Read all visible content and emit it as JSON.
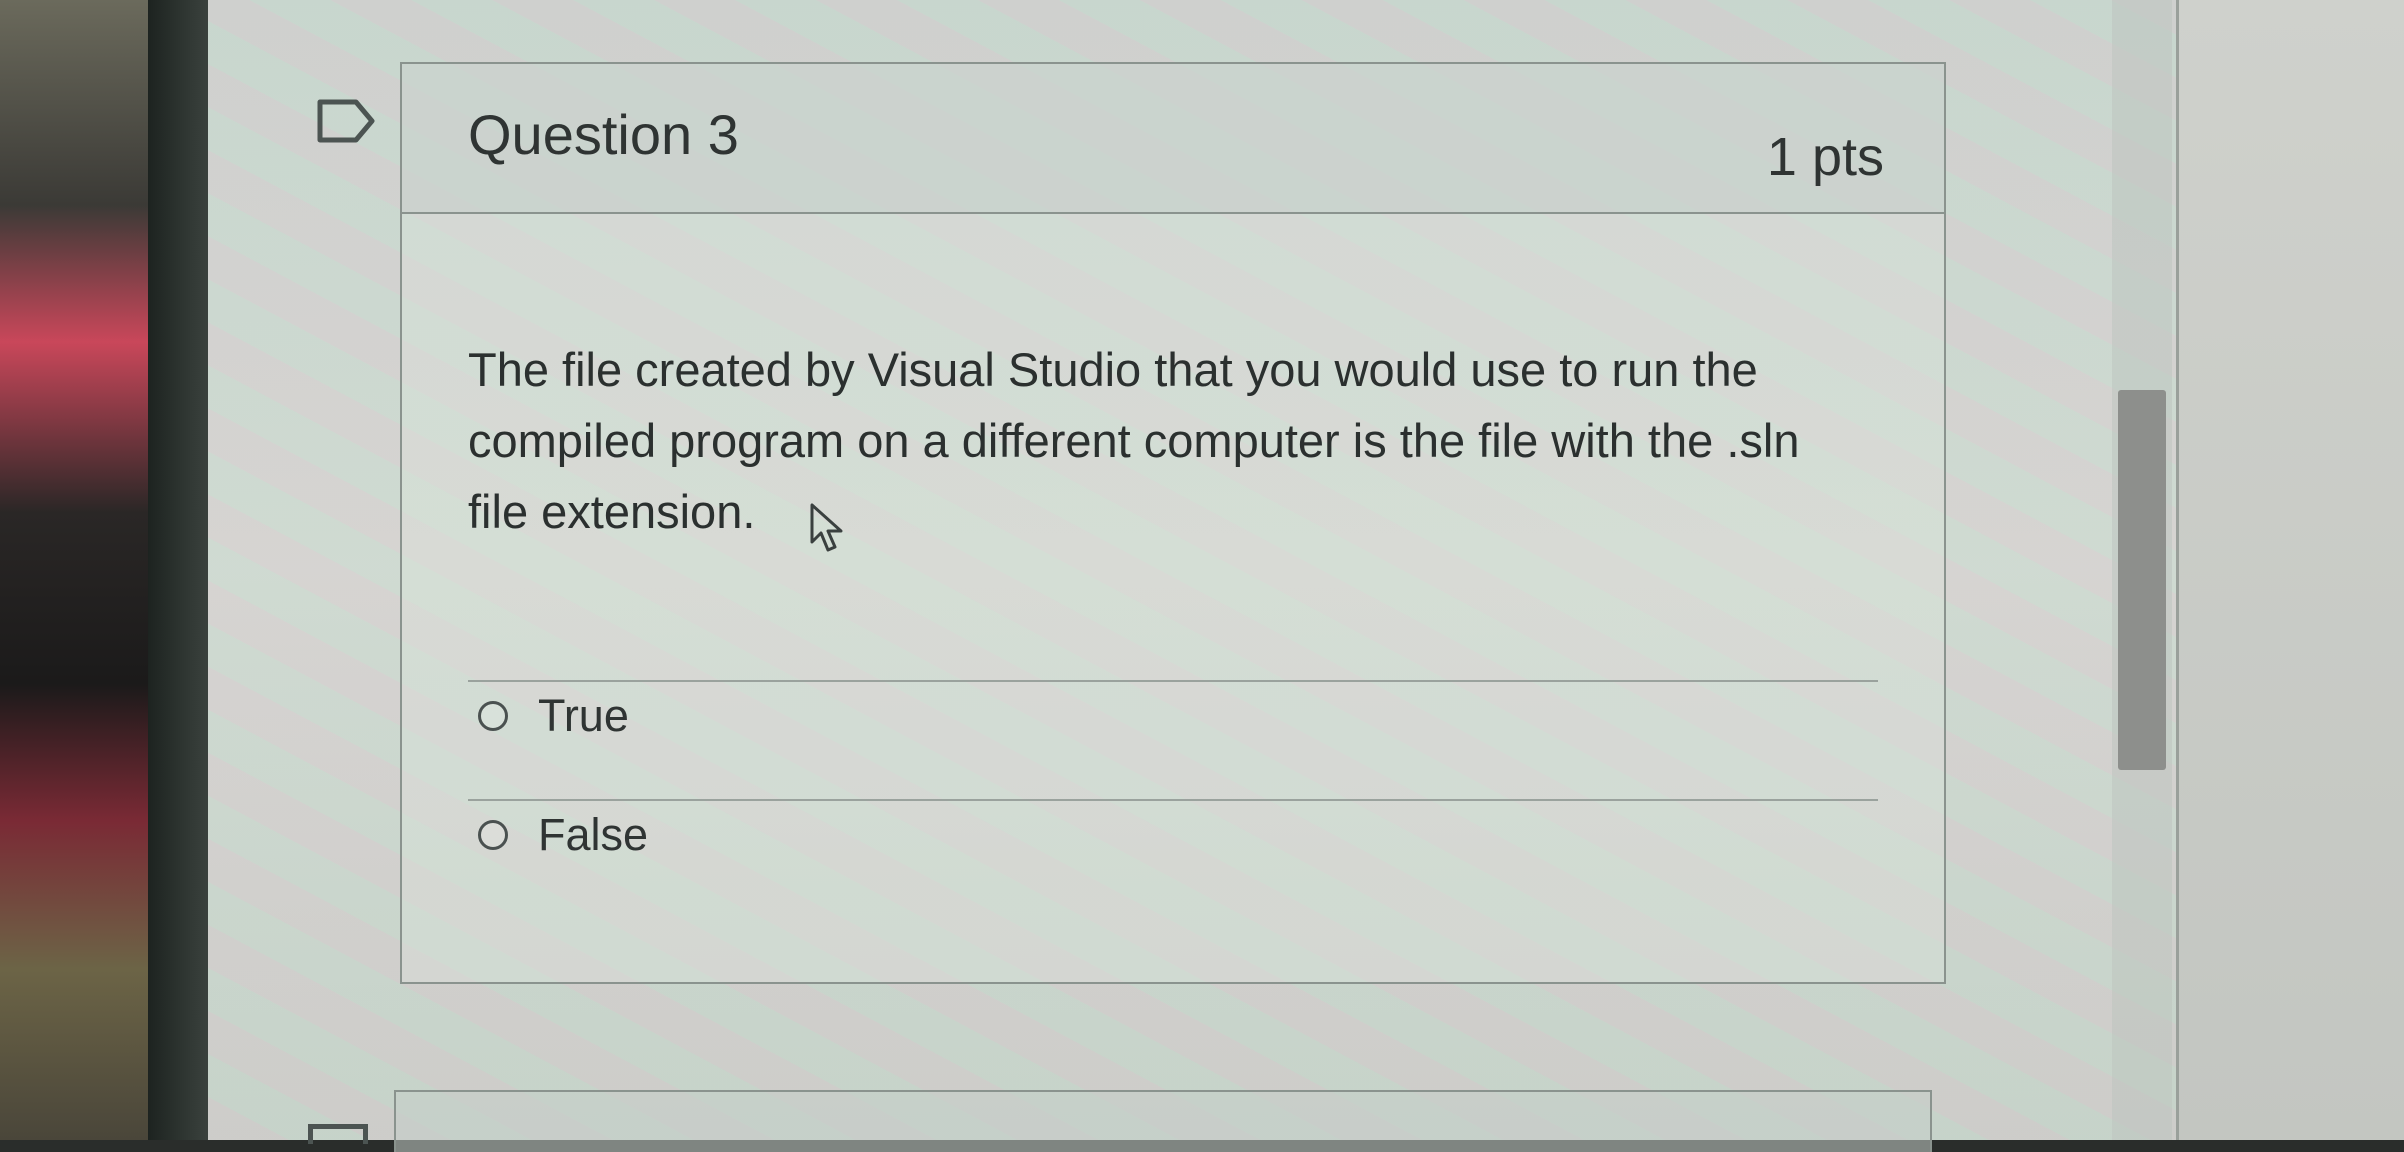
{
  "question": {
    "title": "Question 3",
    "points": "1 pts",
    "text": "The file created by Visual Studio that you would use to run the compiled program on a different computer is the file with the .sln file extension."
  },
  "answers": [
    {
      "label": "True",
      "selected": false
    },
    {
      "label": "False",
      "selected": false
    }
  ],
  "icons": {
    "bookmark": "bookmark-icon",
    "cursor": "mouse-cursor-icon",
    "radio": "radio-button-icon"
  },
  "colors": {
    "text": "#2f3433",
    "border": "#8a938e",
    "header_bg": "#c4cec8"
  }
}
